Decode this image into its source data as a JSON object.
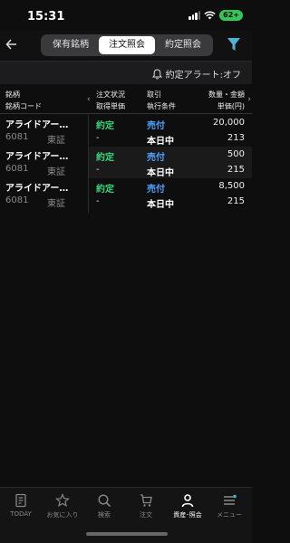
{
  "status_bar": {
    "time": "15:31",
    "battery": "62+"
  },
  "nav": {
    "tabs": [
      {
        "label": "保有銘柄",
        "active": false
      },
      {
        "label": "注文照会",
        "active": true
      },
      {
        "label": "約定照会",
        "active": false
      }
    ]
  },
  "alert": {
    "label": "約定アラート:オフ"
  },
  "table": {
    "headers": {
      "col1_line1": "銘柄",
      "col1_line2": "銘柄コード",
      "col2_line1": "注文状況",
      "col2_line2": "取得単価",
      "col3_line1": "取引",
      "col3_line2": "執行条件",
      "col4_line1": "数量・金額",
      "col4_line2": "単価(円)"
    },
    "rows": [
      {
        "name": "アライドアー…",
        "code": "6081",
        "market": "東証",
        "status": "約定",
        "price": "-",
        "side": "売付",
        "condition": "本日中",
        "quantity": "20,000",
        "unit_price": "213"
      },
      {
        "name": "アライドアー…",
        "code": "6081",
        "market": "東証",
        "status": "約定",
        "price": "-",
        "side": "売付",
        "condition": "本日中",
        "quantity": "500",
        "unit_price": "215"
      },
      {
        "name": "アライドアー…",
        "code": "6081",
        "market": "東証",
        "status": "約定",
        "price": "-",
        "side": "売付",
        "condition": "本日中",
        "quantity": "8,500",
        "unit_price": "215"
      }
    ]
  },
  "tab_bar": {
    "items": [
      {
        "label": "TODAY",
        "active": false
      },
      {
        "label": "お気に入り",
        "active": false
      },
      {
        "label": "検索",
        "active": false
      },
      {
        "label": "注文",
        "active": false
      },
      {
        "label": "資産･照会",
        "active": true
      },
      {
        "label": "メニュー",
        "active": false
      }
    ]
  }
}
